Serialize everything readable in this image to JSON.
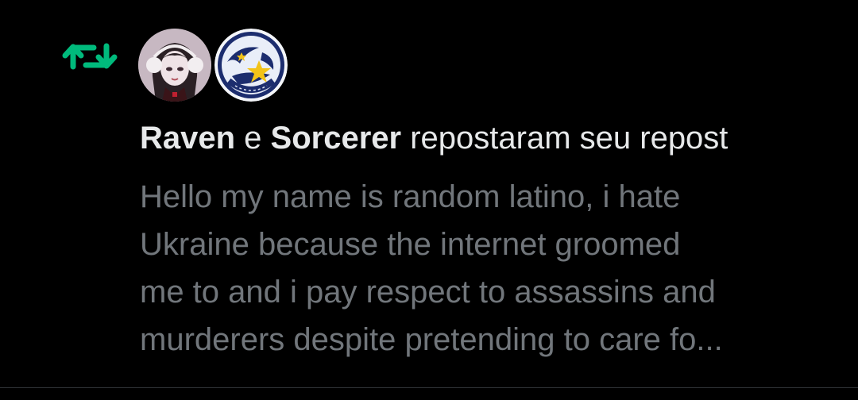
{
  "notification": {
    "type_icon": "repost-icon",
    "accent_color": "#00ba7c",
    "avatars": [
      {
        "user": "Raven",
        "icon": "avatar-raven"
      },
      {
        "user": "Sorcerer",
        "icon": "avatar-sorcerer-star-emblem"
      }
    ],
    "headline": {
      "user1": "Raven",
      "conjunction": " e ",
      "user2": "Sorcerer",
      "action": " repostaram seu repost"
    },
    "post_text_lines": [
      "Hello my name is random latino, i hate",
      "Ukraine because the internet groomed",
      "me to and i pay respect to assassins and",
      "murderers despite pretending to care fo..."
    ],
    "colors": {
      "background": "#000000",
      "primary_text": "#e7e9ea",
      "secondary_text": "#71767b"
    }
  }
}
